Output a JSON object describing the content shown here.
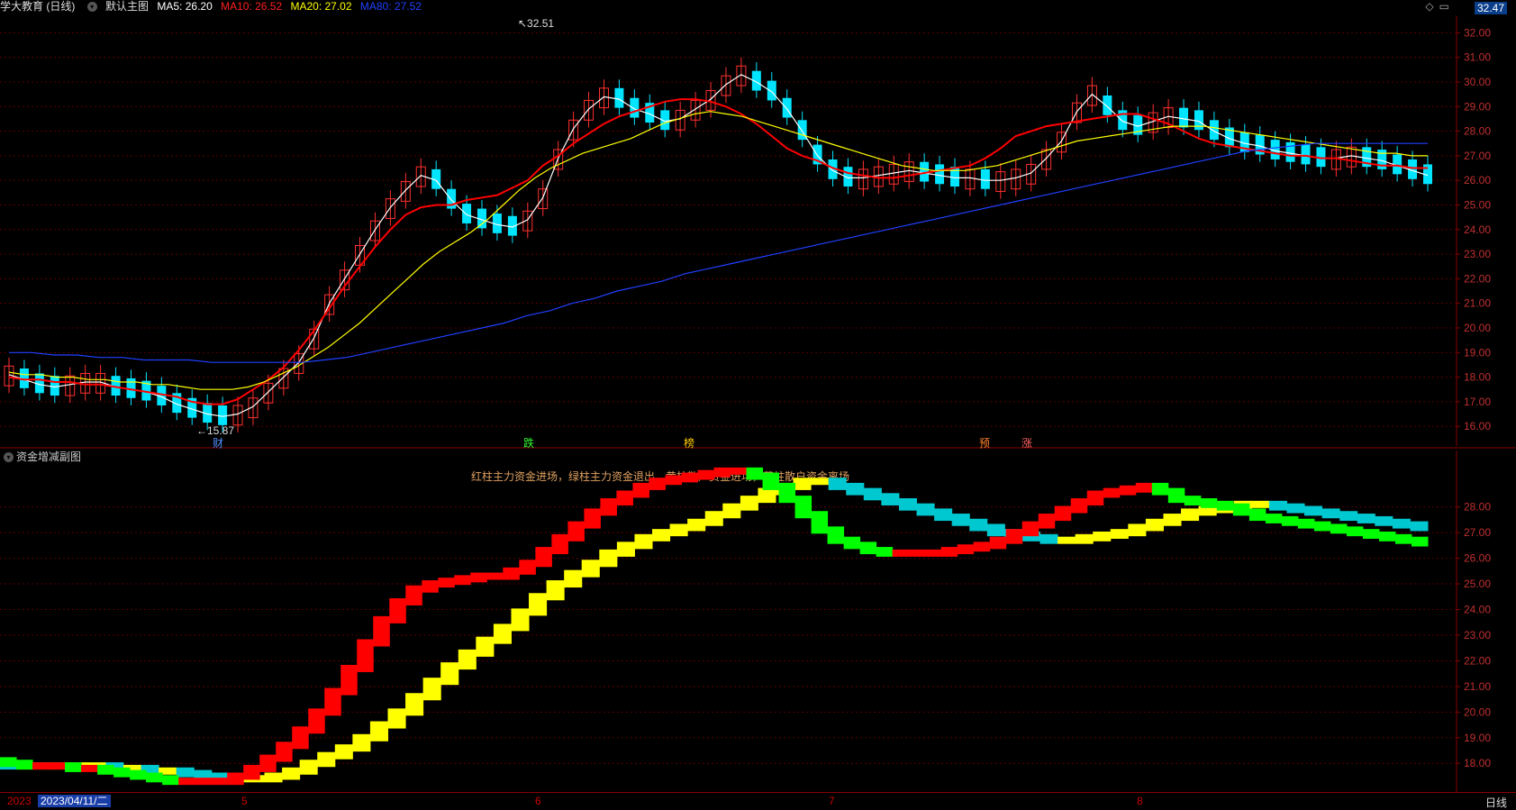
{
  "header": {
    "stock_name": "学大教育 (日线)",
    "template_label": "默认主图",
    "ma5_label": "MA5: 26.20",
    "ma10_label": "MA10: 26.52",
    "ma20_label": "MA20: 27.02",
    "ma80_label": "MA80: 27.52",
    "last_price": "32.47"
  },
  "colors": {
    "up": "#ff3030",
    "down": "#00e5ff",
    "ma5": "#ffffff",
    "ma10": "#ff0000",
    "ma20": "#ffff00",
    "ma80": "#2040ff"
  },
  "sub_panel": {
    "title": "资金增减副图",
    "legend": "红柱主力资金进场，绿柱主力资金退出，黄柱散户资金进场，蓝柱散户资金离场"
  },
  "bottom": {
    "date_prefix": "2023",
    "date": "2023/04/11/二",
    "months": [
      "5",
      "6",
      "7",
      "8"
    ],
    "period": "日线"
  },
  "chart_data": [
    {
      "type": "candlestick",
      "title": "学大教育 (日线)",
      "y_ticks": [
        "32.00",
        "31.00",
        "30.00",
        "29.00",
        "28.00",
        "27.00",
        "26.00",
        "25.00",
        "24.00",
        "23.00",
        "22.00",
        "21.00",
        "20.00",
        "19.00",
        "18.00",
        "17.00",
        "16.00"
      ],
      "ylim": [
        15.2,
        32.6
      ],
      "annotations": {
        "high": "32.51",
        "low": "15.87"
      },
      "event_marks": [
        "财",
        "跌",
        "榜",
        "预",
        "涨"
      ],
      "series": [
        {
          "name": "MA5",
          "values": [
            18.1,
            17.9,
            17.7,
            17.6,
            17.7,
            17.8,
            17.8,
            17.6,
            17.5,
            17.4,
            17.2,
            16.9,
            16.7,
            16.5,
            16.4,
            16.5,
            16.8,
            17.4,
            18.0,
            18.6,
            19.6,
            21.0,
            22.0,
            23.0,
            24.0,
            24.9,
            25.6,
            26.2,
            26.0,
            25.2,
            24.6,
            24.4,
            24.2,
            24.1,
            24.4,
            25.3,
            26.9,
            28.1,
            28.9,
            29.4,
            29.3,
            28.9,
            28.7,
            28.4,
            28.5,
            28.9,
            29.3,
            29.9,
            30.3,
            30.0,
            29.6,
            28.9,
            28.0,
            27.0,
            26.4,
            26.1,
            26.1,
            26.2,
            26.3,
            26.4,
            26.3,
            26.2,
            26.1,
            26.1,
            26.0,
            26.0,
            26.1,
            26.3,
            26.9,
            27.6,
            28.8,
            29.5,
            29.0,
            28.4,
            28.2,
            28.4,
            28.6,
            28.5,
            28.4,
            28.0,
            27.7,
            27.5,
            27.4,
            27.2,
            27.1,
            27.0,
            26.9,
            26.9,
            27.0,
            26.9,
            26.8,
            26.6,
            26.4,
            26.2
          ]
        },
        {
          "name": "MA10",
          "values": [
            18.0,
            17.9,
            17.9,
            17.8,
            17.8,
            17.7,
            17.7,
            17.6,
            17.5,
            17.4,
            17.3,
            17.2,
            17.0,
            16.9,
            16.9,
            17.1,
            17.5,
            17.9,
            18.4,
            19.1,
            19.9,
            20.8,
            21.7,
            22.5,
            23.3,
            24.0,
            24.6,
            24.9,
            25.0,
            25.0,
            25.2,
            25.3,
            25.4,
            25.7,
            26.0,
            26.6,
            27.0,
            27.5,
            27.9,
            28.3,
            28.6,
            28.8,
            29.0,
            29.2,
            29.3,
            29.3,
            29.2,
            29.0,
            28.7,
            28.3,
            27.8,
            27.3,
            27.0,
            26.8,
            26.5,
            26.3,
            26.2,
            26.1,
            26.1,
            26.2,
            26.3,
            26.4,
            26.5,
            26.6,
            26.9,
            27.3,
            27.8,
            28.0,
            28.2,
            28.3,
            28.4,
            28.5,
            28.6,
            28.7,
            28.7,
            28.5,
            28.3,
            28.0,
            27.7,
            27.5,
            27.4,
            27.3,
            27.2,
            27.1,
            27.0,
            27.0,
            26.9,
            26.9,
            26.8,
            26.7,
            26.6,
            26.6,
            26.5,
            26.5
          ]
        },
        {
          "name": "MA20",
          "values": [
            18.2,
            18.1,
            18.1,
            18.0,
            18.0,
            17.9,
            17.9,
            17.8,
            17.8,
            17.7,
            17.7,
            17.6,
            17.5,
            17.5,
            17.5,
            17.6,
            17.8,
            18.1,
            18.4,
            18.8,
            19.2,
            19.7,
            20.2,
            20.8,
            21.4,
            22.0,
            22.6,
            23.1,
            23.5,
            23.9,
            24.4,
            25.0,
            25.6,
            26.1,
            26.5,
            26.8,
            27.1,
            27.3,
            27.5,
            27.7,
            28.0,
            28.3,
            28.5,
            28.7,
            28.8,
            28.7,
            28.6,
            28.4,
            28.2,
            28.0,
            27.8,
            27.6,
            27.4,
            27.2,
            27.0,
            26.8,
            26.6,
            26.5,
            26.4,
            26.4,
            26.4,
            26.5,
            26.6,
            26.8,
            27.0,
            27.2,
            27.4,
            27.6,
            27.7,
            27.8,
            27.9,
            28.0,
            28.1,
            28.2,
            28.2,
            28.2,
            28.1,
            28.0,
            27.9,
            27.8,
            27.7,
            27.6,
            27.5,
            27.4,
            27.3,
            27.2,
            27.1,
            27.1,
            27.0,
            27.0
          ]
        },
        {
          "name": "MA80",
          "values": [
            19.0,
            19.0,
            18.9,
            18.9,
            18.8,
            18.8,
            18.7,
            18.7,
            18.7,
            18.6,
            18.6,
            18.6,
            18.6,
            18.6,
            18.7,
            18.8,
            19.0,
            19.2,
            19.4,
            19.6,
            19.8,
            20.0,
            20.2,
            20.5,
            20.7,
            21.0,
            21.2,
            21.5,
            21.7,
            21.9,
            22.2,
            22.4,
            22.6,
            22.8,
            23.0,
            23.2,
            23.4,
            23.6,
            23.8,
            24.0,
            24.2,
            24.4,
            24.6,
            24.8,
            25.0,
            25.2,
            25.4,
            25.6,
            25.8,
            26.0,
            26.2,
            26.4,
            26.6,
            26.8,
            27.0,
            27.2,
            27.3,
            27.4,
            27.5,
            27.5,
            27.5,
            27.5,
            27.5,
            27.5
          ]
        }
      ]
    },
    {
      "type": "area",
      "title": "资金增减副图",
      "y_ticks": [
        "28.00",
        "27.00",
        "26.00",
        "25.00",
        "24.00",
        "23.00",
        "22.00",
        "21.00",
        "20.00",
        "19.00",
        "18.00"
      ],
      "ylim": [
        17.2,
        29.5
      ],
      "series": [
        {
          "name": "main",
          "values": [
            18.1,
            18.0,
            17.9,
            17.9,
            17.9,
            17.8,
            17.8,
            17.7,
            17.6,
            17.5,
            17.4,
            17.3,
            17.3,
            17.3,
            17.3,
            17.5,
            17.8,
            18.2,
            18.7,
            19.3,
            20.0,
            20.8,
            21.7,
            22.7,
            23.6,
            24.3,
            24.8,
            25.0,
            25.1,
            25.2,
            25.3,
            25.3,
            25.5,
            25.8,
            26.3,
            26.8,
            27.3,
            27.8,
            28.2,
            28.5,
            28.8,
            29.0,
            29.1,
            29.2,
            29.3,
            29.4,
            29.4,
            29.2,
            28.8,
            28.3,
            27.7,
            27.1,
            26.7,
            26.5,
            26.3,
            26.2,
            26.2,
            26.2,
            26.2,
            26.3,
            26.4,
            26.5,
            26.7,
            27.0,
            27.3,
            27.6,
            27.9,
            28.2,
            28.5,
            28.6,
            28.7,
            28.8,
            28.6,
            28.3,
            28.2,
            28.1,
            28.0,
            27.8,
            27.6,
            27.5,
            27.4,
            27.3,
            27.2,
            27.1,
            27.0,
            26.9,
            26.8,
            26.7,
            26.6
          ]
        },
        {
          "name": "retail",
          "values": [
            18.0,
            17.9,
            17.9,
            17.9,
            17.9,
            17.9,
            17.9,
            17.8,
            17.8,
            17.7,
            17.7,
            17.6,
            17.5,
            17.4,
            17.4,
            17.4,
            17.5,
            17.7,
            18.0,
            18.3,
            18.6,
            19.0,
            19.5,
            20.0,
            20.6,
            21.2,
            21.8,
            22.3,
            22.8,
            23.3,
            23.9,
            24.5,
            25.0,
            25.4,
            25.8,
            26.2,
            26.5,
            26.8,
            27.0,
            27.2,
            27.4,
            27.7,
            28.0,
            28.3,
            28.6,
            28.8,
            29.0,
            29.0,
            28.8,
            28.6,
            28.4,
            28.2,
            28.0,
            27.8,
            27.6,
            27.4,
            27.2,
            27.0,
            26.9,
            26.8,
            26.7,
            26.7,
            26.8,
            26.9,
            27.0,
            27.2,
            27.4,
            27.6,
            27.8,
            27.9,
            28.0,
            28.1,
            28.1,
            28.0,
            27.9,
            27.8,
            27.7,
            27.6,
            27.5,
            27.4,
            27.3,
            27.2
          ]
        }
      ]
    }
  ]
}
